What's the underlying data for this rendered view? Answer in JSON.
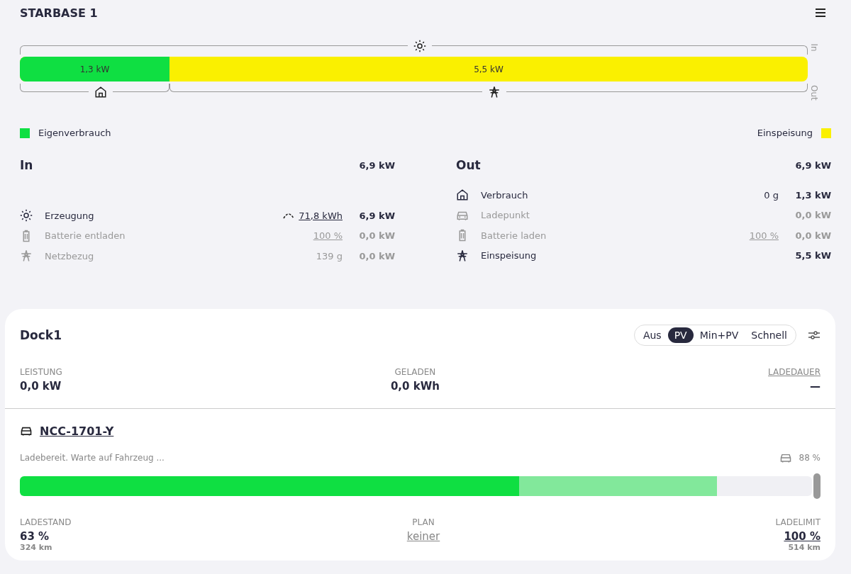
{
  "title": "STARBASE 1",
  "energy_bar": {
    "in_label": "In",
    "out_label": "Out",
    "level": 0.19,
    "self_value": "1,3 kW",
    "feed_value": "5,5 kW"
  },
  "legend": [
    {
      "label": "Eigenverbrauch",
      "color": "#0fdf42"
    },
    {
      "label": "Einspeisung",
      "color": "#faf000"
    }
  ],
  "columns": [
    {
      "title": "In",
      "total": "6,9 kW",
      "rows": [
        {
          "kind": "sun",
          "label": "Erzeugung",
          "extra": "71,8 kWh",
          "extra_link": true,
          "forecast": true,
          "value": "6,9 kW",
          "active": true
        },
        {
          "kind": "battery",
          "label": "Batterie entladen",
          "extra": "100 %",
          "extra_link": true,
          "forecast": false,
          "value": "0,0 kW",
          "active": false
        },
        {
          "kind": "grid",
          "label": "Netzbezug",
          "extra": "139 g",
          "extra_link": false,
          "forecast": false,
          "value": "0,0 kW",
          "active": false
        }
      ]
    },
    {
      "title": "Out",
      "total": "6,9 kW",
      "rows": [
        {
          "kind": "home",
          "label": "Verbrauch",
          "extra": "0 g",
          "extra_link": false,
          "forecast": false,
          "value": "1,3 kW",
          "active": true
        },
        {
          "kind": "car",
          "label": "Ladepunkt",
          "forecast": false,
          "value": "0,0 kW",
          "active": false
        },
        {
          "kind": "battery",
          "label": "Batterie laden",
          "extra": "100 %",
          "extra_link": true,
          "forecast": false,
          "value": "0,0 kW",
          "active": false
        },
        {
          "kind": "grid",
          "label": "Einspeisung",
          "forecast": false,
          "value": "5,5 kW",
          "active": true
        }
      ]
    }
  ],
  "loadpoint": {
    "title": "Dock1",
    "modes": [
      {
        "label": "Aus",
        "selected": false
      },
      {
        "label": "PV",
        "selected": true
      },
      {
        "label": "Min+PV",
        "selected": false
      },
      {
        "label": "Schnell",
        "selected": false
      }
    ],
    "stats": [
      {
        "label": "LEISTUNG",
        "value": "0,0 kW",
        "link": false
      },
      {
        "label": "GELADEN",
        "value": "0,0 kWh",
        "link": false
      },
      {
        "label": "LADEDAUER",
        "value": "—",
        "link": true
      }
    ],
    "vehicle": {
      "name": "NCC-1701-Y",
      "status": "Ladebereit. Warte auf Fahrzeug ...",
      "target_soc": "88 %",
      "soc": {
        "level": 0.63
      },
      "target": {
        "level": 0.88
      },
      "limit": {
        "level": 1.0
      },
      "stats": [
        {
          "label": "LADESTAND",
          "value": "63 %",
          "sub": "324 km",
          "link": false
        },
        {
          "label": "PLAN",
          "value": "keiner",
          "link": true
        },
        {
          "label": "LADELIMIT",
          "value": "100 %",
          "sub": "514 km",
          "link": true
        }
      ]
    }
  }
}
